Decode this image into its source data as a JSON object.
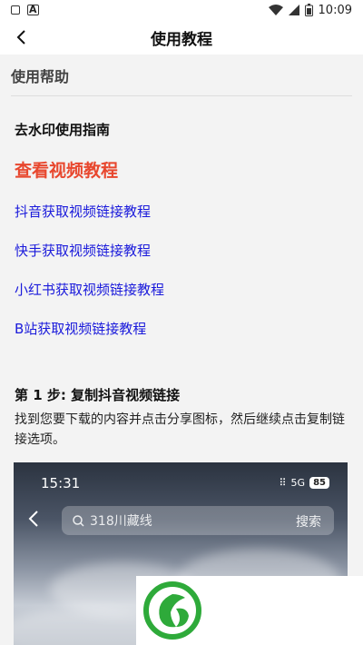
{
  "status_bar": {
    "time": "10:09"
  },
  "header": {
    "title": "使用教程"
  },
  "section": {
    "title": "使用帮助"
  },
  "guide": {
    "title": "去水印使用指南",
    "video_link": "查看视频教程",
    "links": [
      "抖音获取视频链接教程",
      "快手获取视频链接教程",
      "小红书获取视频链接教程",
      "B站获取视频链接教程"
    ]
  },
  "step1": {
    "title": "第 1 步: 复制抖音视频链接",
    "desc": "找到您要下载的内容并点击分享图标，然后继续点击复制链接选项。"
  },
  "screenshot": {
    "time": "15:31",
    "network": "5G",
    "battery": "85",
    "search_placeholder": "318川藏线",
    "search_button": "搜索"
  },
  "colors": {
    "accent_red": "#e8472e",
    "link_blue": "#1a1adb",
    "logo_green": "#2eaa3a"
  }
}
